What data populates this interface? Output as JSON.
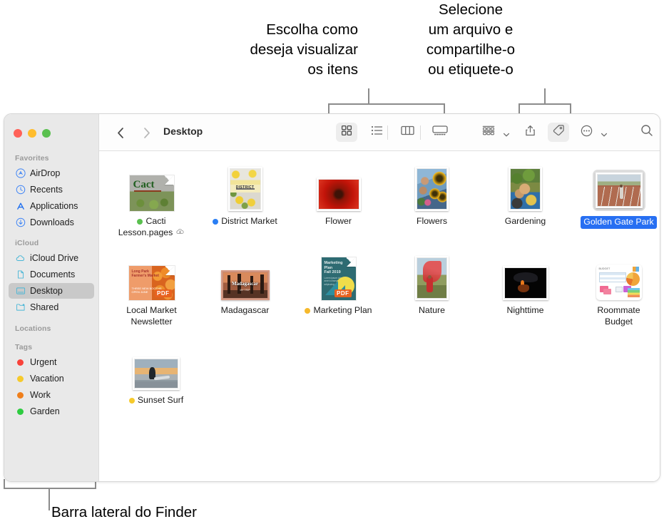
{
  "callouts": {
    "view": "Escolha como\ndeseja visualizar\nos itens",
    "share": "Selecione\num arquivo e\ncompartilhe-o\nou etiquete-o",
    "sidebar": "Barra lateral do Finder"
  },
  "window": {
    "title": "Desktop",
    "traffic_lights": [
      "close",
      "minimize",
      "zoom"
    ],
    "nav": {
      "back": "back-chevron",
      "forward": "forward-chevron"
    }
  },
  "toolbar": {
    "view_buttons": [
      {
        "name": "icon-view",
        "icon": "grid-icon",
        "active": true
      },
      {
        "name": "list-view",
        "icon": "list-icon",
        "active": false
      },
      {
        "name": "column-view",
        "icon": "columns-icon",
        "active": false
      },
      {
        "name": "gallery-view",
        "icon": "gallery-icon",
        "active": false
      }
    ],
    "group_button": {
      "name": "group-by",
      "icon": "group-icon",
      "active": false
    },
    "share_button": {
      "name": "share",
      "icon": "share-icon",
      "active": false
    },
    "tag_button": {
      "name": "tags",
      "icon": "tag-icon",
      "active": true
    },
    "more_button": {
      "name": "more-actions",
      "icon": "ellipsis-circle-icon",
      "active": false
    },
    "search_button": {
      "name": "search",
      "icon": "search-icon",
      "active": false
    }
  },
  "sidebar": {
    "sections": [
      {
        "header": "Favorites",
        "items": [
          {
            "label": "AirDrop",
            "icon": "airdrop-icon",
            "selected": false
          },
          {
            "label": "Recents",
            "icon": "clock-icon",
            "selected": false
          },
          {
            "label": "Applications",
            "icon": "applications-icon",
            "selected": false
          },
          {
            "label": "Downloads",
            "icon": "download-icon",
            "selected": false
          }
        ]
      },
      {
        "header": "iCloud",
        "items": [
          {
            "label": "iCloud Drive",
            "icon": "cloud-icon",
            "selected": false
          },
          {
            "label": "Documents",
            "icon": "document-icon",
            "selected": false
          },
          {
            "label": "Desktop",
            "icon": "desktop-icon",
            "selected": true
          },
          {
            "label": "Shared",
            "icon": "shared-folder-icon",
            "selected": false
          }
        ]
      },
      {
        "header": "Locations",
        "items": []
      },
      {
        "header": "Tags",
        "items": [
          {
            "label": "Urgent",
            "icon": "tag-dot",
            "color": "#f9423a",
            "selected": false
          },
          {
            "label": "Vacation",
            "icon": "tag-dot",
            "color": "#f6ca2c",
            "selected": false
          },
          {
            "label": "Work",
            "icon": "tag-dot",
            "color": "#ef7f1b",
            "selected": false
          },
          {
            "label": "Garden",
            "icon": "tag-dot",
            "color": "#2ecc40",
            "selected": false
          }
        ]
      }
    ]
  },
  "files": {
    "rows": [
      [
        {
          "name": "Cacti\nLesson.pages",
          "tag_color": "#5ac04f",
          "cloud": true,
          "selected": false,
          "kind": "pages-doc"
        },
        {
          "name": "District Market",
          "tag_color": "#2a7ef4",
          "cloud": false,
          "selected": false,
          "kind": "photo-portrait"
        },
        {
          "name": "Flower",
          "tag_color": null,
          "cloud": false,
          "selected": false,
          "kind": "photo-landscape"
        },
        {
          "name": "Flowers",
          "tag_color": null,
          "cloud": false,
          "selected": false,
          "kind": "photo-portrait"
        },
        {
          "name": "Gardening",
          "tag_color": null,
          "cloud": false,
          "selected": false,
          "kind": "photo-portrait"
        },
        {
          "name": "Golden Gate Park",
          "tag_color": null,
          "cloud": false,
          "selected": true,
          "kind": "photo-landscape"
        }
      ],
      [
        {
          "name": "Local Market\nNewsletter",
          "tag_color": null,
          "cloud": false,
          "selected": false,
          "kind": "pdf-doc"
        },
        {
          "name": "Madagascar",
          "tag_color": null,
          "cloud": false,
          "selected": false,
          "kind": "photo-landscape"
        },
        {
          "name": "Marketing Plan",
          "tag_color": "#f6b92c",
          "cloud": false,
          "selected": false,
          "kind": "pdf-doc"
        },
        {
          "name": "Nature",
          "tag_color": null,
          "cloud": false,
          "selected": false,
          "kind": "photo-portrait"
        },
        {
          "name": "Nighttime",
          "tag_color": null,
          "cloud": false,
          "selected": false,
          "kind": "photo-landscape"
        },
        {
          "name": "Roommate\nBudget",
          "tag_color": null,
          "cloud": false,
          "selected": false,
          "kind": "numbers-doc"
        }
      ],
      [
        {
          "name": "Sunset Surf",
          "tag_color": "#f6ca2c",
          "cloud": false,
          "selected": false,
          "kind": "photo-landscape"
        }
      ]
    ]
  },
  "colors": {
    "accent_blue": "#276ff2",
    "sidebar_bg": "#e9e9e9",
    "selection_gray": "#c9c9c9",
    "leader_line": "#8b8b8b"
  }
}
